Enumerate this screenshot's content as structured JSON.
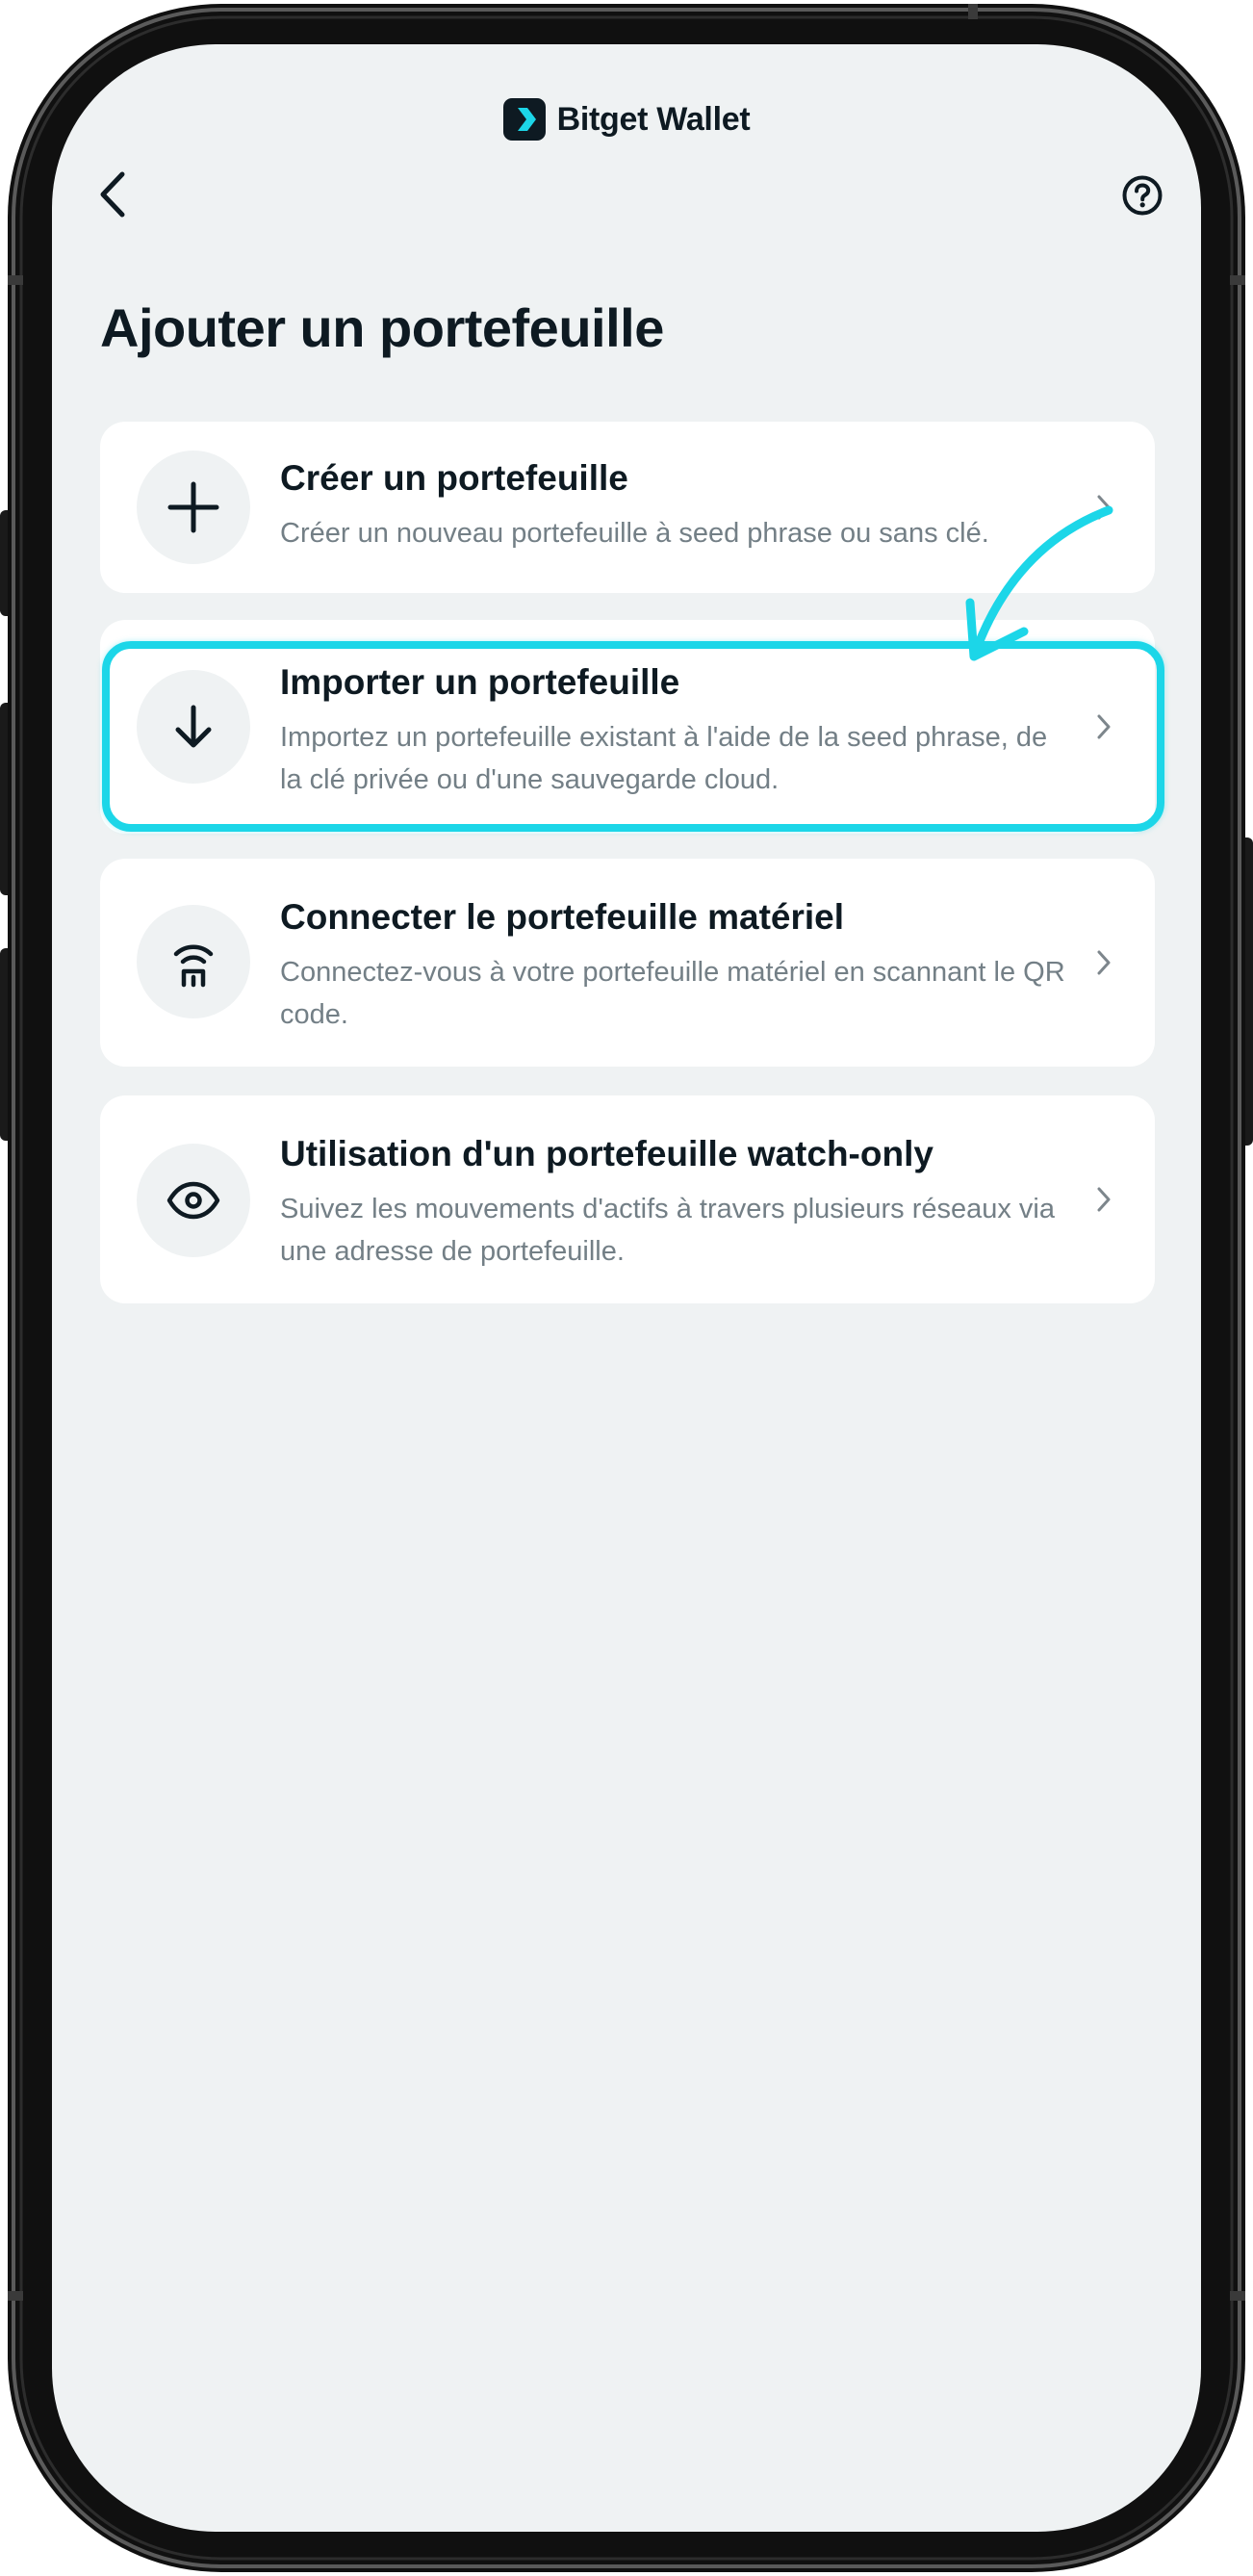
{
  "app": {
    "brand": "Bitget Wallet",
    "accent_color": "#1cd6e8",
    "text_color": "#0e1a22",
    "muted_color": "#737f86",
    "background_color": "#eff2f3"
  },
  "header": {
    "back_icon": "chevron-left-icon",
    "help_icon": "question-circle-icon"
  },
  "page": {
    "title": "Ajouter un portefeuille"
  },
  "options": [
    {
      "icon": "plus-icon",
      "title": "Créer un portefeuille",
      "description": "Créer un nouveau portefeuille à seed phrase ou sans clé."
    },
    {
      "icon": "arrow-down-icon",
      "title": "Importer un portefeuille",
      "description": "Importez un portefeuille existant à l'aide de la seed phrase, de la clé privée ou d'une sauvegarde cloud.",
      "highlighted": true
    },
    {
      "icon": "hardware-wallet-icon",
      "title": "Connecter le portefeuille matériel",
      "description": "Connectez-vous à votre portefeuille matériel en scannant le QR code."
    },
    {
      "icon": "eye-icon",
      "title": "Utilisation d'un portefeuille watch-only",
      "description": "Suivez les mouvements d'actifs à travers plusieurs réseaux via une adresse de portefeuille."
    }
  ]
}
